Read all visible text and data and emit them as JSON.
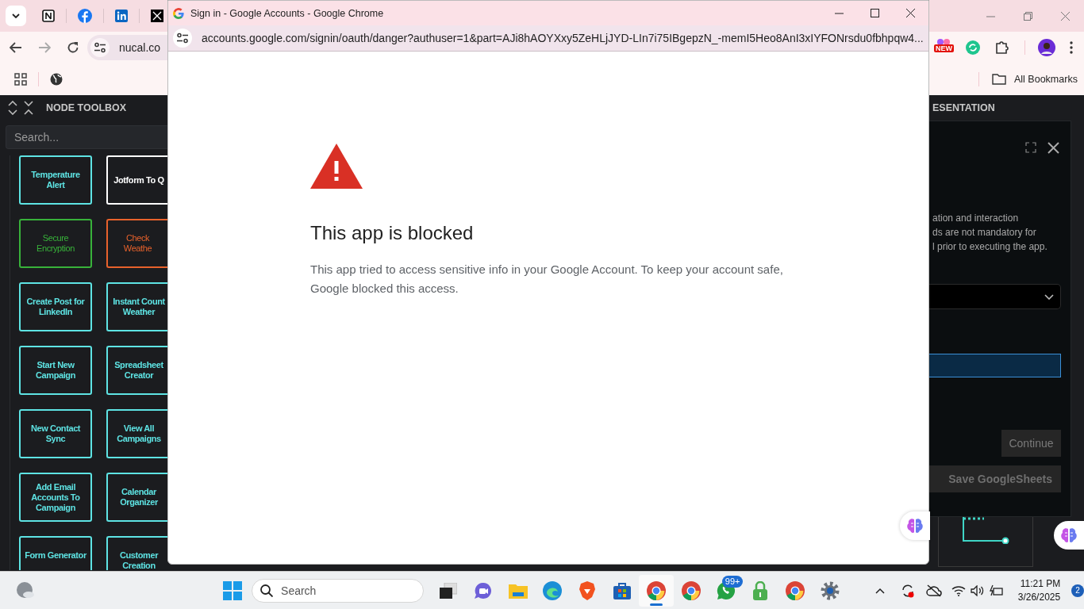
{
  "browser": {
    "address": "nucal.co",
    "bookmarks_label": "All Bookmarks",
    "extension_badge": "NEW"
  },
  "toolbox": {
    "title": "NODE TOOLBOX",
    "search_placeholder": "Search...",
    "nodes": [
      {
        "label": "Temperature Alert",
        "color": "#5ee4e4"
      },
      {
        "label": "Jotform To Q",
        "color": "#ffffff"
      },
      {
        "label": "Secure Encryption",
        "color": "#38b23a"
      },
      {
        "label": "Check Weathe",
        "color": "#e8622c"
      },
      {
        "label": "Create Post for LinkedIn",
        "color": "#5ee4e4"
      },
      {
        "label": "Instant Count Weather",
        "color": "#5ee4e4"
      },
      {
        "label": "Start New Campaign",
        "color": "#5ee4e4"
      },
      {
        "label": "Spreadsheet Creator",
        "color": "#5ee4e4"
      },
      {
        "label": "New Contact Sync",
        "color": "#5ee4e4"
      },
      {
        "label": "View All Campaigns",
        "color": "#5ee4e4"
      },
      {
        "label": "Add Email Accounts To Campaign",
        "color": "#5ee4e4"
      },
      {
        "label": "Calendar Organizer",
        "color": "#5ee4e4"
      },
      {
        "label": "Form Generator",
        "color": "#5ee4e4"
      },
      {
        "label": "Customer Creation",
        "color": "#5ee4e4"
      }
    ]
  },
  "side_panel": {
    "header": "ESENTATION",
    "description_lines": [
      "ation and interaction",
      "ds are not mandatory for",
      "l prior to executing the app."
    ],
    "continue_button": "Continue",
    "save_button": "Save GoogleSheets"
  },
  "popup": {
    "title": "Sign in - Google Accounts - Google Chrome",
    "url": "accounts.google.com/signin/oauth/danger?authuser=1&part=AJi8hAOYXxy5ZeHLjJYD-LIn7i75IBgepzN_-memI5Heo8AnI3xIYFONrsdu0fbhpqw4...",
    "heading": "This app is blocked",
    "message": "This app tried to access sensitive info in your Google Account. To keep your account safe, Google blocked this access."
  },
  "taskbar": {
    "search_label": "Search",
    "chat_badge": "99+",
    "time": "11:21 PM",
    "date": "3/26/2025",
    "notification_count": "2"
  }
}
